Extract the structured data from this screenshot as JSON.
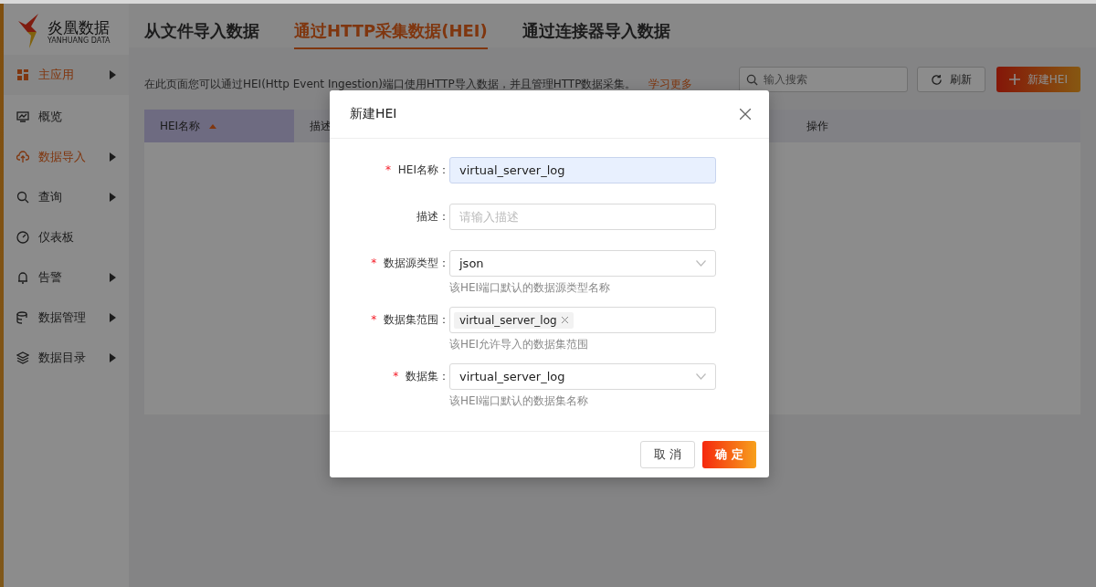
{
  "logo": {
    "name": "炎凰数据",
    "subtitle": "YANHUANG DATA"
  },
  "sidebar": {
    "app_menu": {
      "label": "主应用"
    },
    "items": [
      {
        "label": "概览",
        "selected": false,
        "expandable": false
      },
      {
        "label": "数据导入",
        "selected": true,
        "expandable": true
      },
      {
        "label": "查询",
        "selected": false,
        "expandable": true
      },
      {
        "label": "仪表板",
        "selected": false,
        "expandable": false
      },
      {
        "label": "告警",
        "selected": false,
        "expandable": true
      },
      {
        "label": "数据管理",
        "selected": false,
        "expandable": true
      },
      {
        "label": "数据目录",
        "selected": false,
        "expandable": true
      }
    ]
  },
  "tabs": [
    {
      "label": "从文件导入数据",
      "selected": false
    },
    {
      "label": "通过HTTP采集数据(HEI)",
      "selected": true
    },
    {
      "label": "通过连接器导入数据",
      "selected": false
    }
  ],
  "intro": {
    "text": "在此页面您可以通过HEI(Http Event Ingestion)端口使用HTTP导入数据，并且管理HTTP数据采集。",
    "link": "学习更多"
  },
  "search": {
    "placeholder": "输入搜索"
  },
  "refresh_button": "刷新",
  "new_button": "新建HEI",
  "table": {
    "columns": [
      {
        "label": "HEI名称",
        "sorted": true
      },
      {
        "label": "描述",
        "sorted": false
      },
      {
        "label": "操作",
        "sorted": false
      }
    ]
  },
  "dialog": {
    "title": "新建HEI",
    "fields": [
      {
        "kind": "text",
        "required_mark": "*",
        "label": "HEI名称：",
        "value": "virtual_server_log",
        "focused": true
      },
      {
        "kind": "text",
        "label": "描述：",
        "placeholder": "请输入描述",
        "focused": false
      },
      {
        "kind": "select",
        "required_mark": "*",
        "label": "数据源类型：",
        "value": "json",
        "help": "该HEI端口默认的数据源类型名称"
      },
      {
        "kind": "tags",
        "required_mark": "*",
        "label": "数据集范围：",
        "tags": [
          "virtual_server_log"
        ],
        "help": "该HEI允许导入的数据集范围"
      },
      {
        "kind": "select",
        "required_mark": "*",
        "label": "数据集：",
        "value": "virtual_server_log",
        "help": "该HEI端口默认的数据集名称"
      }
    ],
    "cancel": "取 消",
    "ok": "确 定"
  }
}
